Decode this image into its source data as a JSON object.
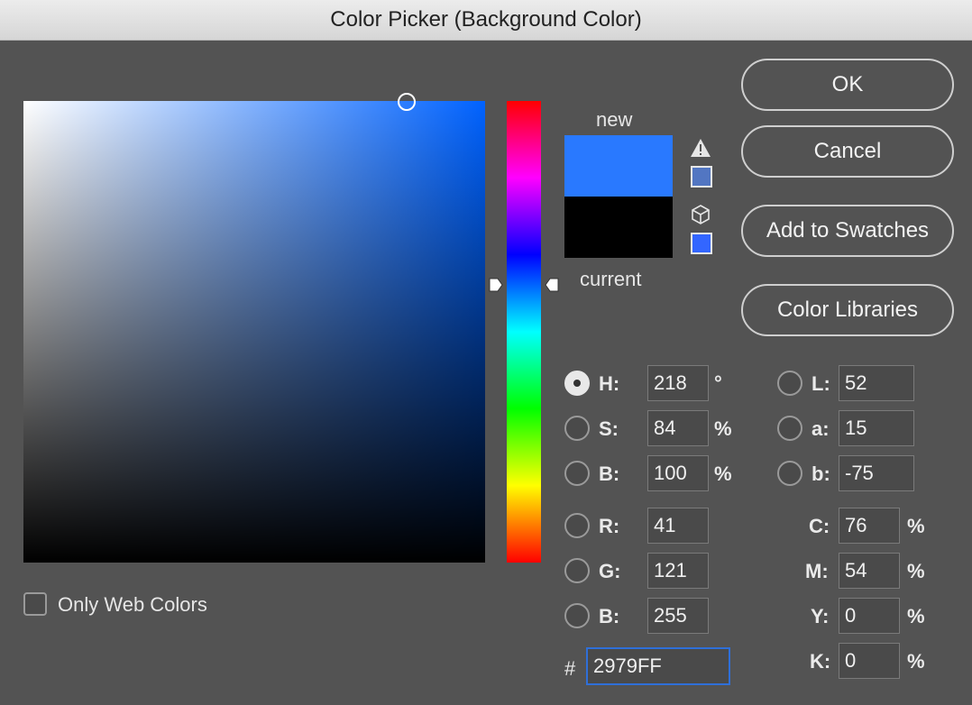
{
  "window": {
    "title": "Color Picker (Background Color)"
  },
  "preview": {
    "new_label": "new",
    "current_label": "current",
    "new_color": "#2979ff",
    "current_color": "#000000",
    "gamut_warning_swatch": "#5276c2",
    "web_safe_swatch": "#3366ff"
  },
  "buttons": {
    "ok": "OK",
    "cancel": "Cancel",
    "add_to_swatches": "Add to Swatches",
    "color_libraries": "Color Libraries"
  },
  "hsb": {
    "h": {
      "label": "H:",
      "value": "218",
      "unit": "°",
      "selected": true
    },
    "s": {
      "label": "S:",
      "value": "84",
      "unit": "%"
    },
    "b": {
      "label": "B:",
      "value": "100",
      "unit": "%"
    }
  },
  "rgb": {
    "r": {
      "label": "R:",
      "value": "41"
    },
    "g": {
      "label": "G:",
      "value": "121"
    },
    "b": {
      "label": "B:",
      "value": "255"
    }
  },
  "lab": {
    "l": {
      "label": "L:",
      "value": "52"
    },
    "a": {
      "label": "a:",
      "value": "15"
    },
    "b": {
      "label": "b:",
      "value": "-75"
    }
  },
  "cmyk": {
    "c": {
      "label": "C:",
      "value": "76",
      "unit": "%"
    },
    "m": {
      "label": "M:",
      "value": "54",
      "unit": "%"
    },
    "y": {
      "label": "Y:",
      "value": "0",
      "unit": "%"
    },
    "k": {
      "label": "K:",
      "value": "0",
      "unit": "%"
    }
  },
  "hex": {
    "label": "#",
    "value": "2979FF"
  },
  "options": {
    "only_web_colors": "Only Web Colors"
  },
  "icons": {
    "gamut_warning": "warning-triangle-icon",
    "web_safe": "cube-icon"
  }
}
